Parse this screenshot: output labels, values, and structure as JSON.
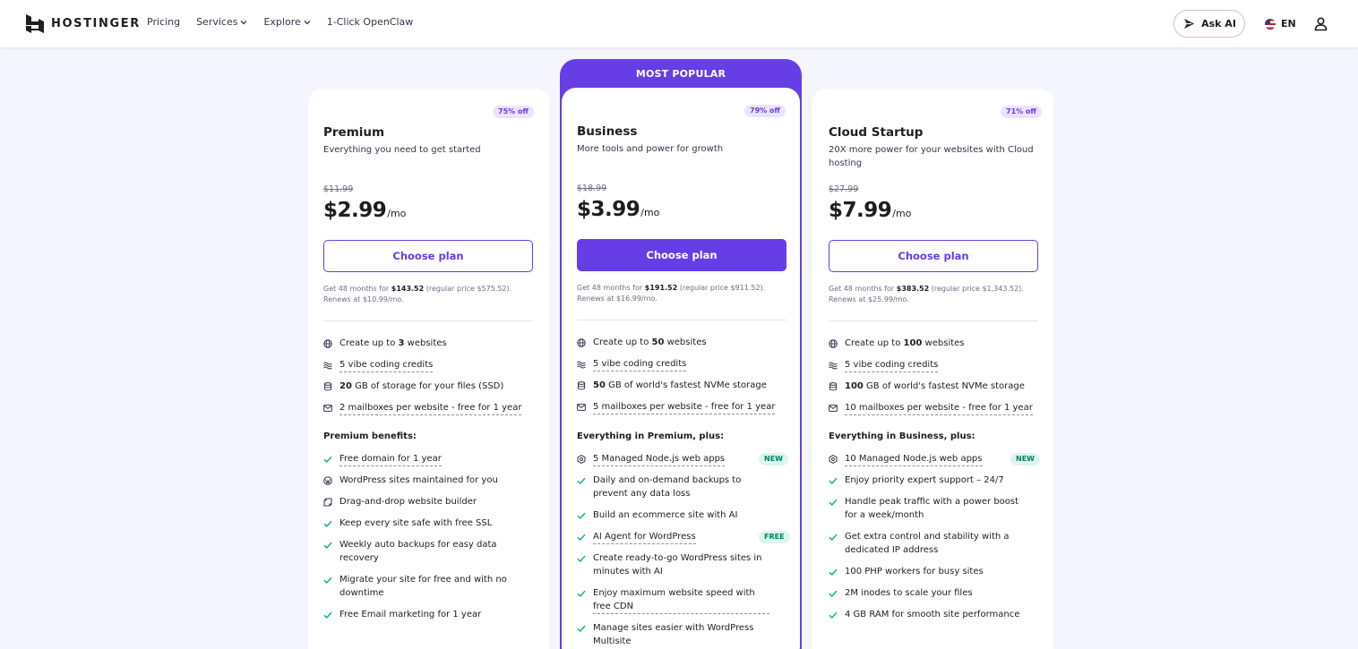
{
  "header": {
    "logo_text": "HOSTINGER",
    "nav": [
      {
        "label": "Pricing",
        "has_chevron": false
      },
      {
        "label": "Services",
        "has_chevron": true
      },
      {
        "label": "Explore",
        "has_chevron": true
      },
      {
        "label": "1-Click OpenClaw",
        "has_chevron": false
      }
    ],
    "ask_ai_label": "Ask AI",
    "language": "EN"
  },
  "colors": {
    "brand": "#673de6",
    "check": "#00b090",
    "background": "#f4f5ff"
  },
  "plans": {
    "premium": {
      "discount": "75% off",
      "name": "Premium",
      "description": "Everything you need to get started",
      "old_price": "$11.99",
      "price": "$2.99",
      "per": "/mo",
      "button": "Choose plan",
      "fine_prefix": "Get 48 months for ",
      "fine_total": "$143.52",
      "fine_regular": " (regular price $575.52).",
      "fine_renew": "Renews at $10.99/mo.",
      "core": [
        {
          "icon": "globe-icon",
          "pre": "Create up to ",
          "bold": "3",
          "post": " websites",
          "underline": false
        },
        {
          "icon": "vibe-icon",
          "pre": "",
          "bold": "",
          "post": "5 vibe coding credits",
          "underline": true
        },
        {
          "icon": "storage-icon",
          "pre": "",
          "bold": "20",
          "post": " GB of storage for your files (SSD)",
          "underline": false
        },
        {
          "icon": "mail-icon",
          "pre": "",
          "bold": "",
          "post": "2 mailboxes per website - free for 1 year",
          "underline": true
        }
      ],
      "section_title": "Premium benefits:",
      "benefits": [
        {
          "icon": "check-icon",
          "text": "Free domain for 1 year",
          "underline": true
        },
        {
          "icon": "wordpress-icon",
          "text": "WordPress sites maintained for you",
          "underline": false
        },
        {
          "icon": "builder-icon",
          "text": "Drag-and-drop website builder",
          "underline": false
        },
        {
          "icon": "check-icon",
          "text": "Keep every site safe with free SSL",
          "underline": false
        },
        {
          "icon": "check-icon",
          "text": "Weekly auto backups for easy data recovery",
          "underline": false
        },
        {
          "icon": "check-icon",
          "text": "Migrate your site for free and with no downtime",
          "underline": false
        },
        {
          "icon": "check-icon",
          "text": "Free Email marketing for 1 year",
          "underline": false
        }
      ]
    },
    "business": {
      "popular": "MOST POPULAR",
      "discount": "79% off",
      "name": "Business",
      "description": "More tools and power for growth",
      "old_price": "$18.99",
      "price": "$3.99",
      "per": "/mo",
      "button": "Choose plan",
      "fine_prefix": "Get 48 months for ",
      "fine_total": "$191.52",
      "fine_regular": " (regular price $911.52).",
      "fine_renew": "Renews at $16.99/mo.",
      "core": [
        {
          "icon": "globe-icon",
          "pre": "Create up to ",
          "bold": "50",
          "post": " websites",
          "underline": false
        },
        {
          "icon": "vibe-icon",
          "pre": "",
          "bold": "",
          "post": "5 vibe coding credits",
          "underline": true
        },
        {
          "icon": "storage-icon",
          "pre": "",
          "bold": "50",
          "post": " GB of world's fastest NVMe storage",
          "underline": false
        },
        {
          "icon": "mail-icon",
          "pre": "",
          "bold": "",
          "post": "5 mailboxes per website - free for 1 year",
          "underline": true
        }
      ],
      "section_title": "Everything in Premium, plus:",
      "benefits": [
        {
          "icon": "nodejs-icon",
          "text": "5 Managed Node.js web apps",
          "underline": true,
          "tag": "NEW"
        },
        {
          "icon": "check-icon",
          "text": "Daily and on-demand backups to prevent any data loss",
          "underline": false
        },
        {
          "icon": "check-icon",
          "text": "Build an ecommerce site with AI",
          "underline": false
        },
        {
          "icon": "check-icon",
          "text": "AI Agent for WordPress",
          "underline": true,
          "tag": "FREE"
        },
        {
          "icon": "check-icon",
          "text": "Create ready-to-go WordPress sites in minutes with AI",
          "underline": false
        },
        {
          "icon": "check-icon",
          "text": "Enjoy maximum website speed with free CDN",
          "underline": true
        },
        {
          "icon": "check-icon",
          "text": "Manage sites easier with WordPress Multisite",
          "underline": false
        }
      ]
    },
    "cloud": {
      "discount": "71% off",
      "name": "Cloud Startup",
      "description": "20X more power for your websites with Cloud hosting",
      "old_price": "$27.99",
      "price": "$7.99",
      "per": "/mo",
      "button": "Choose plan",
      "fine_prefix": "Get 48 months for ",
      "fine_total": "$383.52",
      "fine_regular": " (regular price $1,343.52).",
      "fine_renew": "Renews at $25.99/mo.",
      "core": [
        {
          "icon": "globe-icon",
          "pre": "Create up to ",
          "bold": "100",
          "post": " websites",
          "underline": false
        },
        {
          "icon": "vibe-icon",
          "pre": "",
          "bold": "",
          "post": "5 vibe coding credits",
          "underline": true
        },
        {
          "icon": "storage-icon",
          "pre": "",
          "bold": "100",
          "post": " GB of world's fastest NVMe storage",
          "underline": false
        },
        {
          "icon": "mail-icon",
          "pre": "",
          "bold": "",
          "post": "10 mailboxes per website - free for 1 year",
          "underline": true
        }
      ],
      "section_title": "Everything in Business, plus:",
      "benefits": [
        {
          "icon": "nodejs-icon",
          "text": "10 Managed Node.js web apps",
          "underline": true,
          "tag": "NEW"
        },
        {
          "icon": "check-icon",
          "text": "Enjoy priority expert support – 24/7",
          "underline": false
        },
        {
          "icon": "check-icon",
          "text": "Handle peak traffic with a power boost for a week/month",
          "underline": false
        },
        {
          "icon": "check-icon",
          "text": "Get extra control and stability with a dedicated IP address",
          "underline": false
        },
        {
          "icon": "check-icon",
          "text": "100 PHP workers for busy sites",
          "underline": false
        },
        {
          "icon": "check-icon",
          "text": "2M inodes to scale your files",
          "underline": false
        },
        {
          "icon": "check-icon",
          "text": "4 GB RAM for smooth site performance",
          "underline": false
        }
      ]
    }
  }
}
